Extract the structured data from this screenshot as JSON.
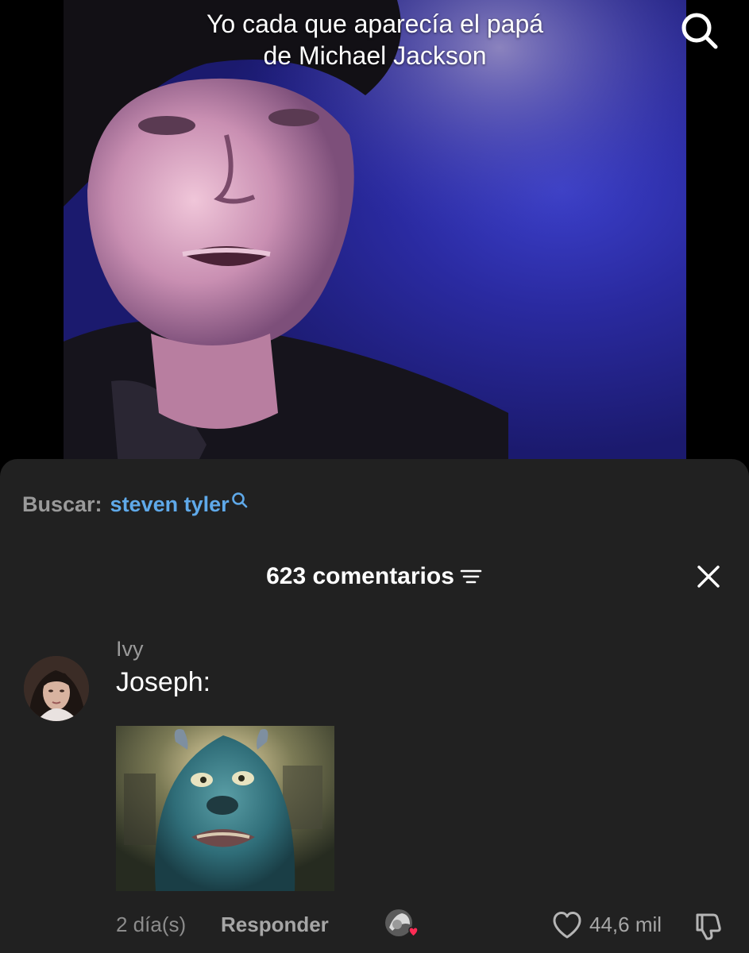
{
  "video": {
    "caption_line1": "Yo cada que aparecía el papá",
    "caption_line2": "de Michael Jackson",
    "search_icon": "search-icon"
  },
  "sheet": {
    "search_label": "Buscar:",
    "search_term": "steven tyler",
    "search_term_icon": "search-icon",
    "comment_count": "623 comentarios",
    "sort_icon": "filter-lines-icon",
    "close_icon": "close-icon"
  },
  "comment": {
    "username": "Ivy",
    "text": "Joseph:",
    "time": "2 día(s)",
    "reply_label": "Responder",
    "likes": "44,6 mil",
    "like_icon": "heart-icon",
    "dislike_icon": "thumbs-down-icon"
  },
  "colors": {
    "sheet_bg": "#212121",
    "link": "#5fa9e9",
    "muted_text": "#9a9a9a",
    "video_blue": "#2a2aa0"
  }
}
